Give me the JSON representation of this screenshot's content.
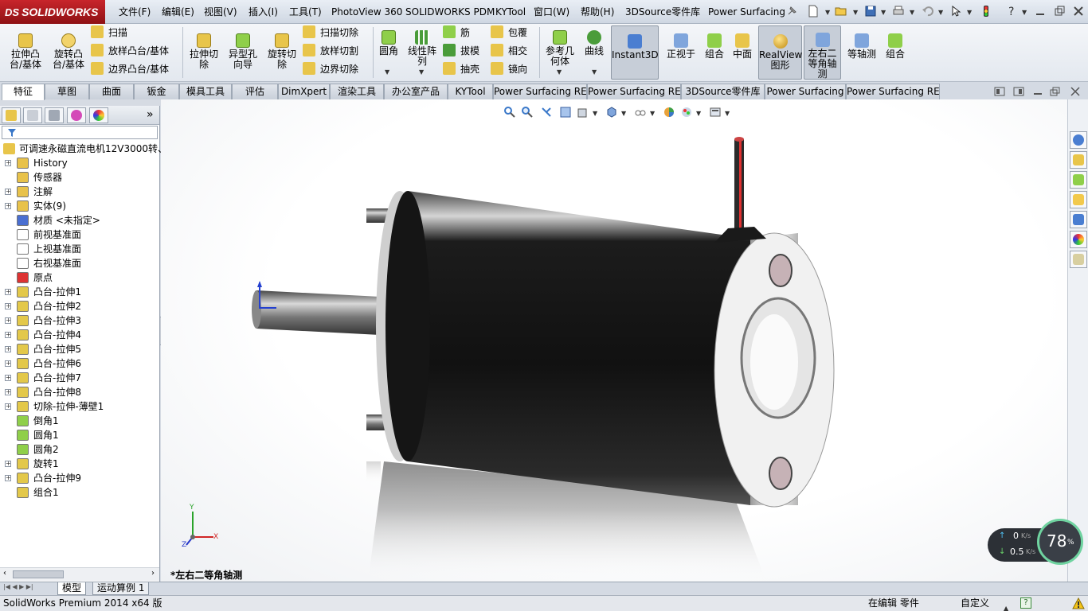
{
  "app": {
    "logo_text": "SOLIDWORKS",
    "logo_mark": "DS"
  },
  "menu": {
    "items": [
      "文件(F)",
      "编辑(E)",
      "视图(V)",
      "插入(I)",
      "工具(T)",
      "PhotoView 360",
      "SOLIDWORKS PDM",
      "KYTool",
      "窗口(W)",
      "帮助(H)",
      "3DSource零件库",
      "Power Surfacing"
    ]
  },
  "ribbon": {
    "extrude_boss": "拉伸凸\n台/基体",
    "revolve_boss": "旋转凸\n台/基体",
    "sweep": "扫描",
    "loft_boss": "放样凸台/基体",
    "boundary_boss": "边界凸台/基体",
    "extrude_cut": "拉伸切\n除",
    "hole_wizard": "异型孔\n向导",
    "revolve_cut": "旋转切\n除",
    "swept_cut": "扫描切除",
    "lofted_cut": "放样切割",
    "boundary_cut": "边界切除",
    "fillet": "圆角",
    "linear_pattern": "线性阵\n列",
    "rib": "筋",
    "draft": "拔模",
    "shell": "抽壳",
    "wrap": "包覆",
    "intersect": "相交",
    "mirror": "镜向",
    "ref_geometry": "参考几\n何体",
    "curves": "曲线",
    "instant3d": "Instant3D",
    "normal_to": "正视于",
    "combine": "组合",
    "midplane": "中面",
    "realview": "RealView\n图形",
    "dimetric": "左右二\n等角轴\n测",
    "isometric": "等轴测",
    "combine2": "组合"
  },
  "tabs": [
    "特征",
    "草图",
    "曲面",
    "钣金",
    "模具工具",
    "评估",
    "DimXpert",
    "渲染工具",
    "办公室产品",
    "KYTool",
    "Power Surfacing RE",
    "Power Surfacing RE",
    "3DSource零件库",
    "Power Surfacing",
    "Power Surfacing RE"
  ],
  "tree": {
    "root": "可调速永磁直流电机12V3000转、",
    "items": [
      {
        "label": "History",
        "exp": true,
        "color": "#e8c24a"
      },
      {
        "label": "传感器",
        "exp": false,
        "color": "#e8c24a"
      },
      {
        "label": "注解",
        "exp": true,
        "color": "#e8c24a"
      },
      {
        "label": "实体(9)",
        "exp": true,
        "color": "#e8c24a"
      },
      {
        "label": "材质 <未指定>",
        "exp": false,
        "color": "#4a6fd1"
      },
      {
        "label": "前视基准面",
        "exp": false,
        "color": "#ffffff"
      },
      {
        "label": "上视基准面",
        "exp": false,
        "color": "#ffffff"
      },
      {
        "label": "右视基准面",
        "exp": false,
        "color": "#ffffff"
      },
      {
        "label": "原点",
        "exp": false,
        "color": "#d33"
      },
      {
        "label": "凸台-拉伸1",
        "exp": true,
        "color": "#e3c84a"
      },
      {
        "label": "凸台-拉伸2",
        "exp": true,
        "color": "#e3c84a"
      },
      {
        "label": "凸台-拉伸3",
        "exp": true,
        "color": "#e3c84a"
      },
      {
        "label": "凸台-拉伸4",
        "exp": true,
        "color": "#e3c84a"
      },
      {
        "label": "凸台-拉伸5",
        "exp": true,
        "color": "#e3c84a"
      },
      {
        "label": "凸台-拉伸6",
        "exp": true,
        "color": "#e3c84a"
      },
      {
        "label": "凸台-拉伸7",
        "exp": true,
        "color": "#e3c84a"
      },
      {
        "label": "凸台-拉伸8",
        "exp": true,
        "color": "#e3c84a"
      },
      {
        "label": "切除-拉伸-薄壁1",
        "exp": true,
        "color": "#e3c84a"
      },
      {
        "label": "倒角1",
        "exp": false,
        "color": "#8fcf4a"
      },
      {
        "label": "圆角1",
        "exp": false,
        "color": "#8fcf4a"
      },
      {
        "label": "圆角2",
        "exp": false,
        "color": "#8fcf4a"
      },
      {
        "label": "旋转1",
        "exp": true,
        "color": "#e3c84a"
      },
      {
        "label": "凸台-拉伸9",
        "exp": true,
        "color": "#e3c84a"
      },
      {
        "label": "组合1",
        "exp": false,
        "color": "#e3c84a"
      }
    ]
  },
  "model_tabs": [
    "模型",
    "运动算例 1"
  ],
  "viewport": {
    "view_label": "*左右二等角轴测",
    "triad": {
      "x": "X",
      "y": "Y",
      "z": "Z"
    }
  },
  "status": {
    "left": "SolidWorks Premium 2014 x64 版",
    "editing": "在编辑 零件",
    "units": "自定义",
    "help": "?"
  },
  "netwidget": {
    "upload": "0",
    "upload_unit": "K/s",
    "download": "0.5",
    "download_unit": "K/s",
    "percent": "78",
    "percent_sign": "%"
  }
}
